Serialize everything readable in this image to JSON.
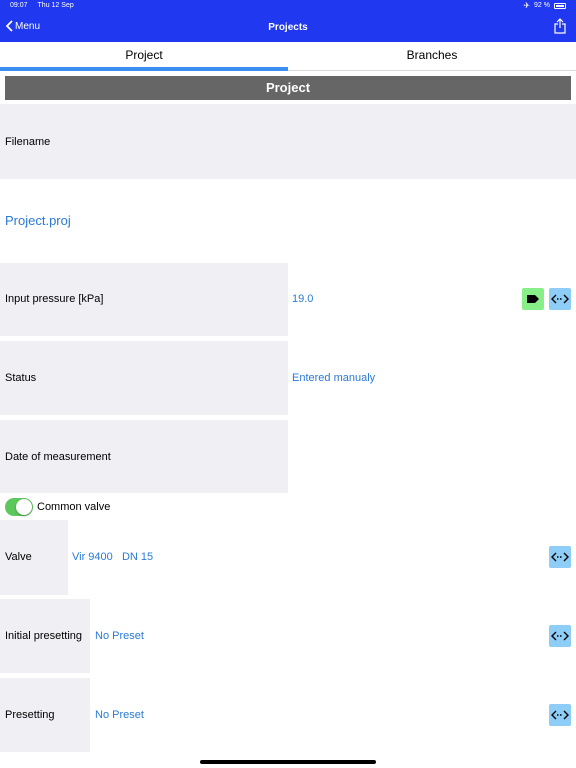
{
  "status_bar": {
    "time": "09:07",
    "date": "Thu 12 Sep",
    "battery": "92 %"
  },
  "nav": {
    "back_label": "Menu",
    "title": "Projects"
  },
  "tabs": [
    {
      "label": "Project",
      "active": true
    },
    {
      "label": "Branches",
      "active": false
    }
  ],
  "section_title": "Project",
  "fields": {
    "filename_label": "Filename",
    "filename_value": "Project.proj",
    "input_pressure_label": "Input pressure [kPa]",
    "input_pressure_value": "19.0",
    "status_label": "Status",
    "status_value": "Entered manualy",
    "date_label": "Date of measurement",
    "common_valve_label": "Common valve",
    "common_valve_on": true,
    "valve_label": "Valve",
    "valve_value": "Vir 9400   DN 15",
    "initial_presetting_label": "Initial presetting",
    "initial_presetting_value": "No Preset",
    "presetting_label": "Presetting",
    "presetting_value": "No Preset"
  },
  "colors": {
    "header": "#1f38f0",
    "accent": "#3b8ff0",
    "value_text": "#2a7ad6",
    "arrow_button": "#8ecdf6",
    "tag_button": "#88ee88",
    "toggle_on": "#5cc85c"
  },
  "icons": {
    "back": "chevron-left-icon",
    "share": "share-icon",
    "tag": "tag-icon",
    "arrows": "left-right-arrows-icon",
    "airplane": "airplane-icon",
    "battery": "battery-icon"
  }
}
